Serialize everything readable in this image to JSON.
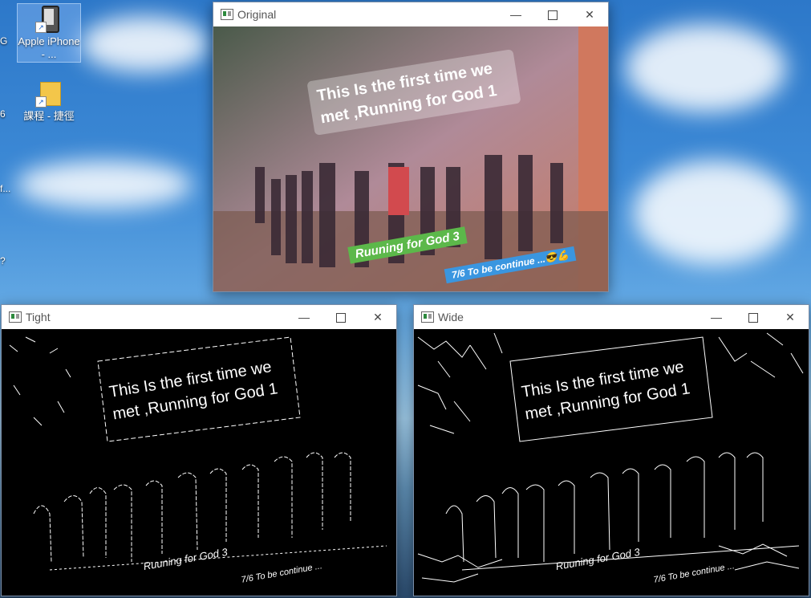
{
  "desktop": {
    "icons": [
      {
        "label": "Apple iPhone - ...",
        "icon": "iphone-device-icon"
      },
      {
        "label": "課程 - 捷徑",
        "icon": "folder-shortcut-icon"
      }
    ],
    "edge_fragments": [
      "G",
      "6",
      "f...",
      "?"
    ]
  },
  "windows": {
    "original": {
      "title": "Original",
      "caption": "This Is the first time we met ,Running for God 1",
      "tag_green": "Ruuning for God 3",
      "tag_blue": "7/6 To be continue ...😎💪"
    },
    "tight": {
      "title": "Tight",
      "caption": "This Is the first time we met ,Running for God 1",
      "tag_green": "Ruuning for God 3",
      "tag_blue": "7/6 To be continue ..."
    },
    "wide": {
      "title": "Wide",
      "caption": "This Is the first time we met ,Running for God 1",
      "tag_green": "Ruuning for God 3",
      "tag_blue": "7/6 To be continue ..."
    }
  },
  "controls": {
    "minimize": "—",
    "close": "✕"
  },
  "colors": {
    "tag_green": "#5cb84a",
    "tag_blue": "#3a96e0",
    "edge_stroke": "#ffffff"
  }
}
